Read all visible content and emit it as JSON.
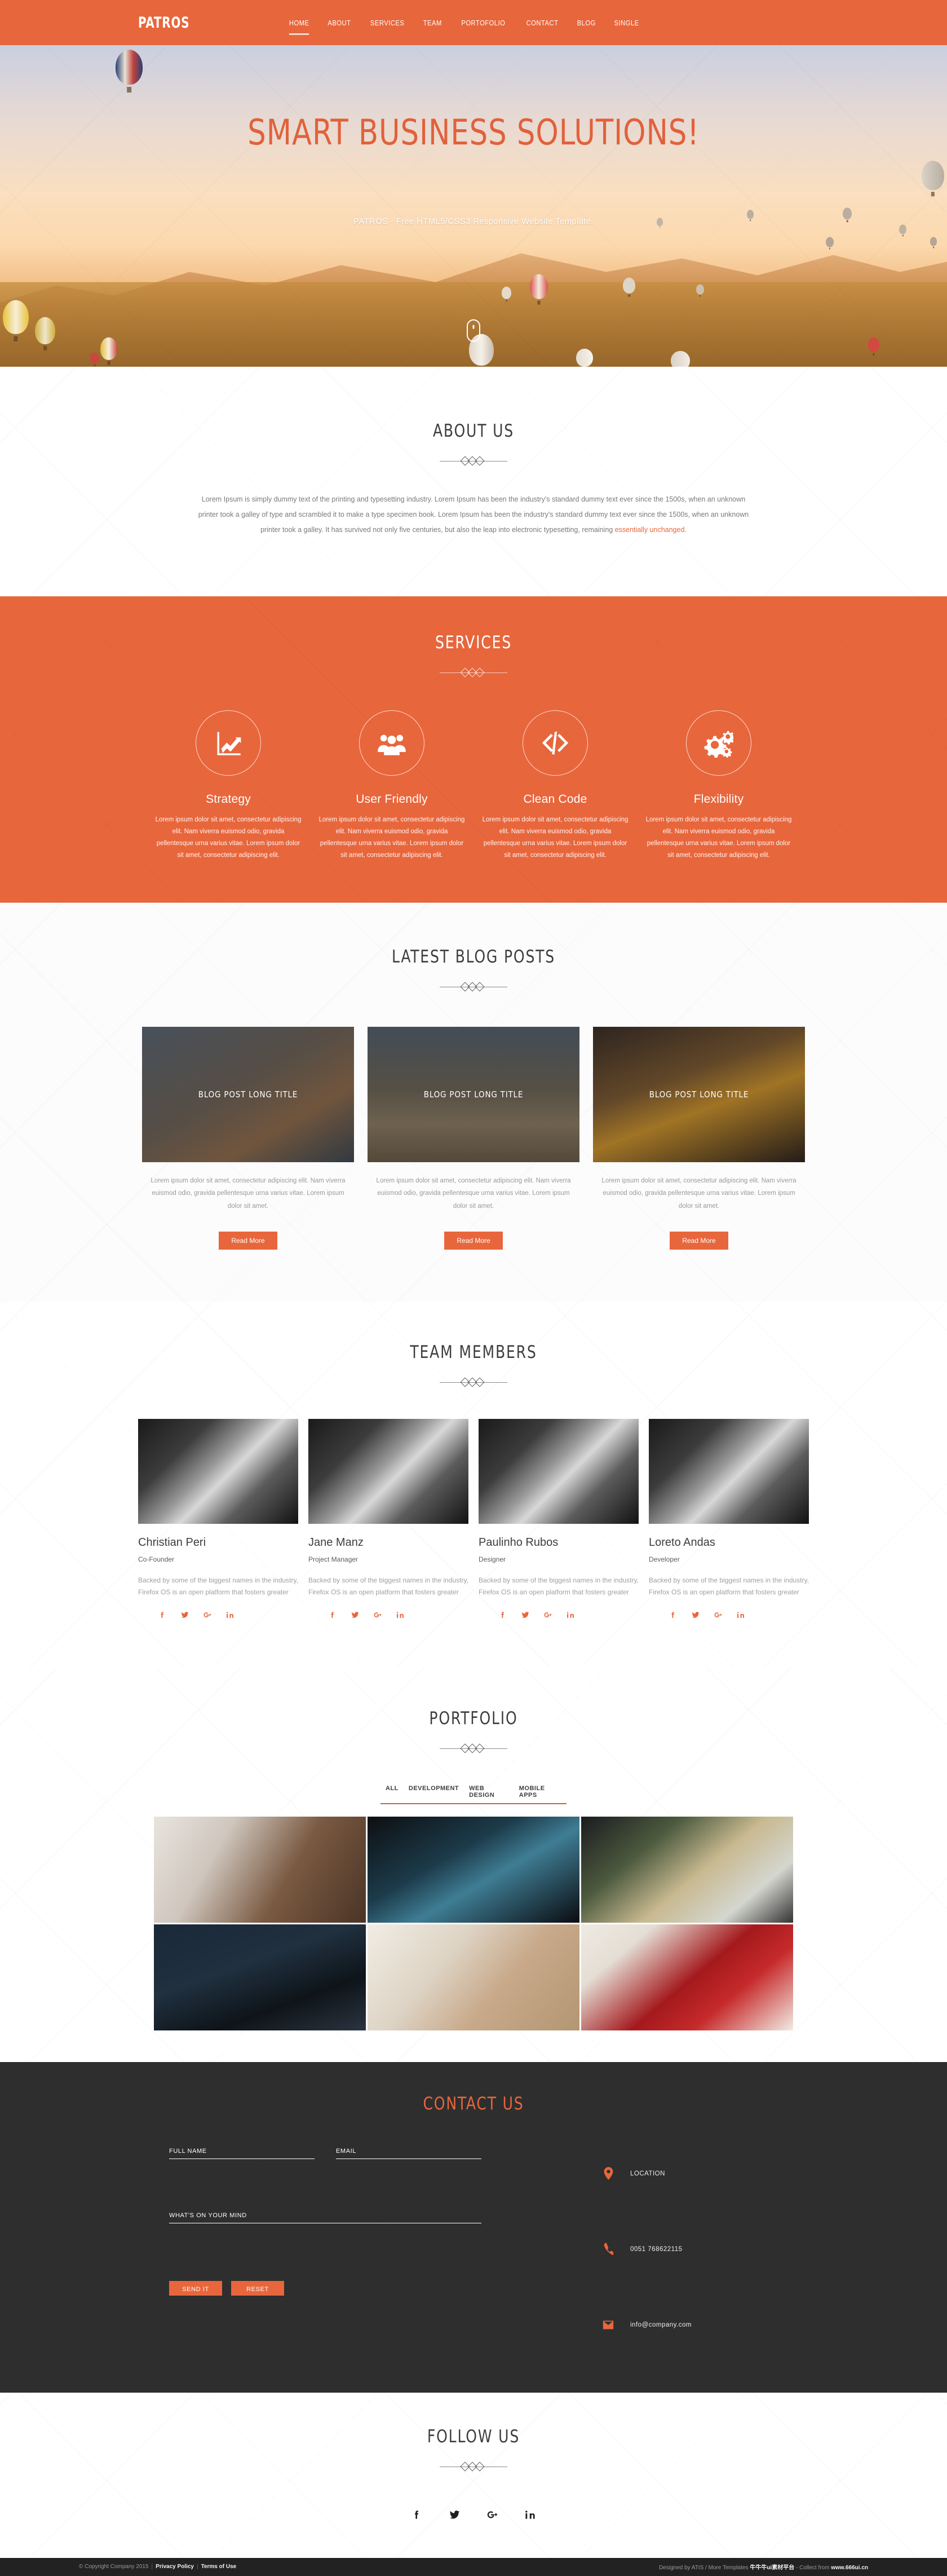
{
  "header": {
    "logo": "PATROS",
    "nav": [
      {
        "label": "HOME",
        "active": true
      },
      {
        "label": "ABOUT",
        "active": false
      },
      {
        "label": "SERVICES",
        "active": false
      },
      {
        "label": "TEAM",
        "active": false
      },
      {
        "label": "PORTOFOLIO",
        "active": false
      },
      {
        "label": "CONTACT",
        "active": false
      },
      {
        "label": "BLOG",
        "active": false
      },
      {
        "label": "SINGLE",
        "active": false
      }
    ],
    "accent_color": "#e8663c"
  },
  "hero": {
    "title": "SMART BUSINESS SOLUTIONS!",
    "subtitle": "PATROS - Free HTML5/CSS3 Responsive Website Template.",
    "title_color": "#e1613b",
    "scroll_icon": "mouse-scroll-icon"
  },
  "about": {
    "title": "ABOUT US",
    "paragraph": "Lorem Ipsum is simply dummy text of the printing and typesetting industry. Lorem Ipsum has been the industry's standard dummy text ever since the 1500s, when an unknown printer took a galley of type and scrambled it to make a type specimen book. Lorem Ipsum has been the industry's standard dummy text ever since the 1500s, when an unknown printer took a galley. It has survived not only five centuries, but also the leap into electronic typesetting, remaining ",
    "link_text": "essentially unchanged.",
    "link_color": "#e8663c"
  },
  "services": {
    "title": "SERVICES",
    "bg_color": "#e8663c",
    "items": [
      {
        "icon": "chart-line-up-icon",
        "title": "Strategy",
        "text": "Lorem ipsum dolor sit amet, consectetur adipiscing elit. Nam viverra euismod odio, gravida pellentesque urna varius vitae. Lorem ipsum dolor sit amet, consectetur adipiscing elit."
      },
      {
        "icon": "users-group-icon",
        "title": "User Friendly",
        "text": "Lorem ipsum dolor sit amet, consectetur adipiscing elit. Nam viverra euismod odio, gravida pellentesque urna varius vitae. Lorem ipsum dolor sit amet, consectetur adipiscing elit."
      },
      {
        "icon": "code-brackets-icon",
        "title": "Clean Code",
        "text": "Lorem ipsum dolor sit amet, consectetur adipiscing elit. Nam viverra euismod odio, gravida pellentesque urna varius vitae. Lorem ipsum dolor sit amet, consectetur adipiscing elit."
      },
      {
        "icon": "gears-cogs-icon",
        "title": "Flexibility",
        "text": "Lorem ipsum dolor sit amet, consectetur adipiscing elit. Nam viverra euismod odio, gravida pellentesque urna varius vitae. Lorem ipsum dolor sit amet, consectetur adipiscing elit."
      }
    ]
  },
  "blog": {
    "title": "LATEST BLOG POSTS",
    "posts": [
      {
        "title": "BLOG POST LONG TITLE",
        "excerpt": "Lorem ipsum dolor sit amet, consectetur adipiscing elit. Nam viverra euismod odio, gravida pellentesque urna varius vitae. Lorem ipsum dolor sit amet.",
        "button": "Read More"
      },
      {
        "title": "BLOG POST LONG TITLE",
        "excerpt": "Lorem ipsum dolor sit amet, consectetur adipiscing elit. Nam viverra euismod odio, gravida pellentesque urna varius vitae. Lorem ipsum dolor sit amet.",
        "button": "Read More"
      },
      {
        "title": "BLOG POST LONG TITLE",
        "excerpt": "Lorem ipsum dolor sit amet, consectetur adipiscing elit. Nam viverra euismod odio, gravida pellentesque urna varius vitae. Lorem ipsum dolor sit amet.",
        "button": "Read More"
      }
    ]
  },
  "team": {
    "title": "TEAM MEMBERS",
    "social_icons": [
      "facebook-icon",
      "twitter-icon",
      "google-plus-icon",
      "linkedin-icon"
    ],
    "members": [
      {
        "name": "Christian Peri",
        "role": "Co-Founder",
        "bio": "Backed by some of the biggest names in the industry, Firefox OS is an open platform that fosters greater"
      },
      {
        "name": "Jane Manz",
        "role": "Project Manager",
        "bio": "Backed by some of the biggest names in the industry, Firefox OS is an open platform that fosters greater"
      },
      {
        "name": "Paulinho Rubos",
        "role": "Designer",
        "bio": "Backed by some of the biggest names in the industry, Firefox OS is an open platform that fosters greater"
      },
      {
        "name": "Loreto Andas",
        "role": "Developer",
        "bio": "Backed by some of the biggest names in the industry, Firefox OS is an open platform that fosters greater"
      }
    ]
  },
  "portfolio": {
    "title": "PORTFOLIO",
    "filters": [
      {
        "label": "ALL",
        "active": true
      },
      {
        "label": "DEVELOPMENT",
        "active": false
      },
      {
        "label": "WEB DESIGN",
        "active": false
      },
      {
        "label": "MOBILE APPS",
        "active": false
      }
    ],
    "items": [
      {
        "alt": "desk-speaker-monitor"
      },
      {
        "alt": "hand-holding-smartphone"
      },
      {
        "alt": "hand-on-mixing-console"
      },
      {
        "alt": "game-controller-on-table"
      },
      {
        "alt": "laptop-books-desk-flatlay"
      },
      {
        "alt": "raspberries-in-white-cup"
      }
    ]
  },
  "contact": {
    "title": "CONTACT US",
    "title_color": "#e8663c",
    "bg_color": "#2e2e2e",
    "fields": {
      "name_placeholder": "FULL NAME",
      "name_value": "",
      "email_placeholder": "EMAIL",
      "email_value": "",
      "message_placeholder": "WHAT'S ON YOUR MIND",
      "message_value": ""
    },
    "buttons": {
      "send": "SEND IT",
      "reset": "RESET"
    },
    "info": [
      {
        "icon": "map-pin-icon",
        "text": "LOCATION"
      },
      {
        "icon": "phone-icon",
        "text": "0051 768622115"
      },
      {
        "icon": "envelope-icon",
        "text": "info@company.com"
      }
    ]
  },
  "follow": {
    "title": "FOLLOW US",
    "icons": [
      "facebook-icon",
      "twitter-icon",
      "google-plus-icon",
      "linkedin-icon"
    ]
  },
  "footer": {
    "copyright": "© Copyright Company 2015",
    "privacy": "Privacy Policy",
    "terms": "Terms of Use",
    "credit_prefix": "Designed by ATIS / More Templates ",
    "credit_cn": "牛牛牛ui素材平台",
    "credit_mid": " - Collect from ",
    "credit_site": "www.666ui.cn"
  }
}
